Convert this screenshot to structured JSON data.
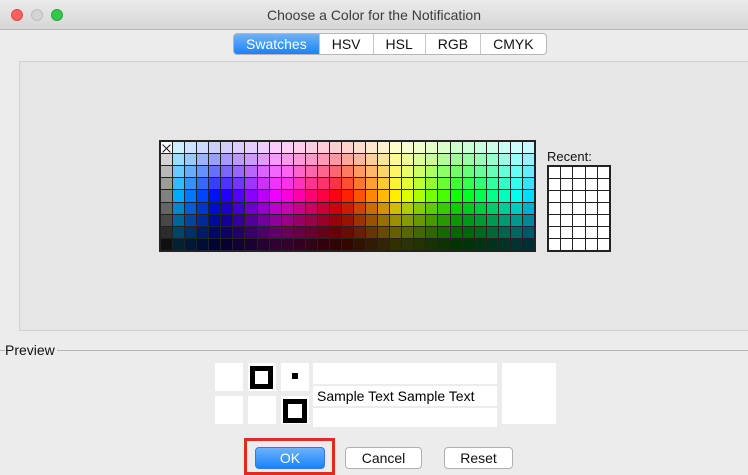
{
  "window": {
    "title": "Choose a Color for the Notification",
    "controls": [
      "close",
      "minimize",
      "maximize"
    ]
  },
  "tabs": [
    {
      "label": "Swatches",
      "active": true
    },
    {
      "label": "HSV",
      "active": false
    },
    {
      "label": "HSL",
      "active": false
    },
    {
      "label": "RGB",
      "active": false
    },
    {
      "label": "CMYK",
      "active": false
    }
  ],
  "swatches": {
    "columns": 31,
    "rows": 9
  },
  "recent": {
    "label": "Recent:",
    "columns": 5,
    "rows": 7
  },
  "preview": {
    "label": "Preview",
    "sample_text_white": "Sample Text  Sample Text",
    "sample_text_black": "Sample Text  Sample Text"
  },
  "buttons": {
    "ok": "OK",
    "cancel": "Cancel",
    "reset": "Reset"
  },
  "colors": {
    "accent": "#1a82fb",
    "highlight": "#e02b1f"
  }
}
